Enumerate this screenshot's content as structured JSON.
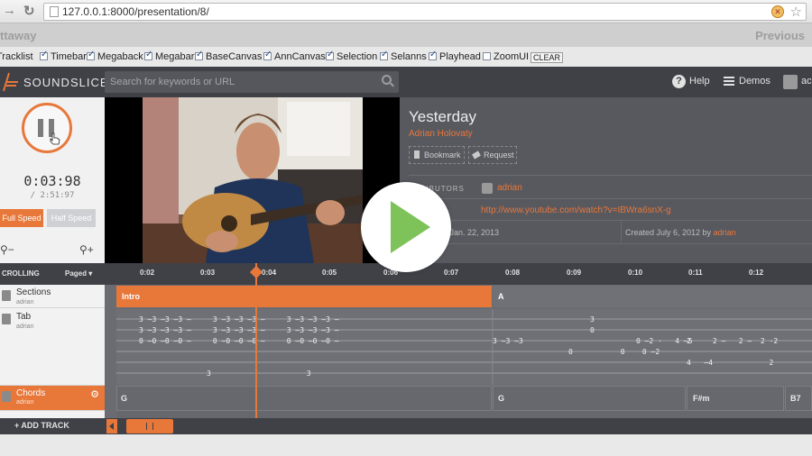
{
  "browser": {
    "url": "127.0.0.1:8000/presentation/8/"
  },
  "presentation": {
    "prev_label": "ttaway",
    "next_label": "Previous"
  },
  "toggles": [
    {
      "label": "Tracklist",
      "checked": true
    },
    {
      "label": "Timebar",
      "checked": true
    },
    {
      "label": "Megaback",
      "checked": true
    },
    {
      "label": "Megabar",
      "checked": true
    },
    {
      "label": "BaseCanvas",
      "checked": true
    },
    {
      "label": "AnnCanvas",
      "checked": true
    },
    {
      "label": "Selection",
      "checked": true
    },
    {
      "label": "Selanns",
      "checked": true
    },
    {
      "label": "Playhead",
      "checked": true
    },
    {
      "label": "ZoomUI",
      "checked": false
    }
  ],
  "clear_label": "CLEAR",
  "header": {
    "brand": "SOUNDSLICE",
    "search_placeholder": "Search for keywords or URL",
    "help": "Help",
    "demos": "Demos",
    "user": "ac"
  },
  "player": {
    "current_time": "0:03:98",
    "total_time": "/ 2:51:97",
    "full_speed": "Full Speed",
    "half_speed": "Half Speed",
    "zoom_out": "⚲−",
    "zoom_in": "⚲+"
  },
  "song": {
    "title": "Yesterday",
    "artist": "Adrian Holovaty",
    "bookmark": "Bookmark",
    "request": "Request",
    "contributors_label": "NTRIBUTORS",
    "contributor": "adrian",
    "video_url": "http://www.youtube.com/watch?v=IBWra6snX-g",
    "updated": "d Jan. 22, 2013",
    "created_prefix": "Created July 6, 2012 by ",
    "created_by": "adrian"
  },
  "timeline": {
    "scrolling": "CROLLING",
    "paged": "Paged ▾",
    "ticks": [
      "0:02",
      "0:03",
      "0:04",
      "0:05",
      "0:06",
      "0:07",
      "0:08",
      "0:09",
      "0:10",
      "0:11",
      "0:12"
    ]
  },
  "tracks": [
    {
      "title": "Sections",
      "user": "adrian"
    },
    {
      "title": "Tab",
      "user": "adrian"
    },
    {
      "title": "Chords",
      "user": "adrian"
    }
  ],
  "sections": [
    "Intro",
    "A"
  ],
  "chords": [
    "G",
    "G",
    "F#m",
    "B7"
  ],
  "tab_lines": [
    "3 —3 —3 —3 —     3 —3 —3 —3 —     3 —3 —3 —3 —",
    "3 —3 —3 —3 —     3 —3 —3 —3 —     3 —3 —3 —3 —",
    "0 —0 —0 —0 —     0 —0 —0 —0 —     0 —0 —0 —0 —"
  ],
  "tab_right": {
    "line1": "3",
    "line2": "0",
    "line3": "3 —3 —3                          0 —2 ·   4 –5",
    "line4": "2     2 –   2 –  2 ·2",
    "line5": "0           0    0 —2",
    "line6": "4   —4             2",
    "line7": "3                      3"
  },
  "bottom": {
    "add_track": "+ ADD TRACK"
  }
}
